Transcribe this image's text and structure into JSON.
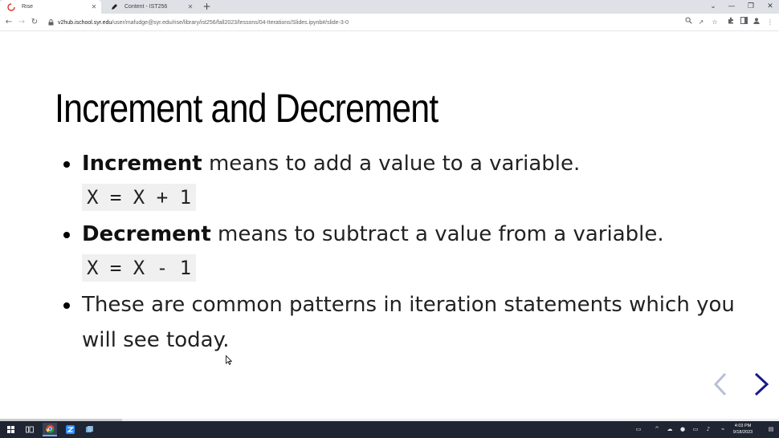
{
  "browser": {
    "tabs": [
      {
        "title": "Rise",
        "active": true,
        "icon": "loading-spinner-icon"
      },
      {
        "title": "Content - IST256",
        "active": false,
        "icon": "pen-icon"
      }
    ],
    "url_host": "v2hub.ischool.syr.edu",
    "url_path": "/user/mafudge@syr.edu/rise/library/ist256/fall2023/lessons/04-Iterations/Slides.ipynb#/slide-3-0"
  },
  "slide": {
    "title": "Increment and Decrement",
    "bullet1": {
      "term": "Increment",
      "rest": " means to add a value to a variable."
    },
    "code1": "X = X + 1",
    "bullet2": {
      "term": "Decrement",
      "rest": " means to subtract a value from a variable."
    },
    "code2": "X = X - 1",
    "bullet3": "These are common patterns in iteration statements which you will see today.",
    "progress_fraction": 0.157
  },
  "taskbar": {
    "time": "4:03 PM",
    "date": "9/18/2023"
  },
  "colors": {
    "accent_arrow": "#1a1a8c",
    "taskbar": "#1f2533"
  }
}
